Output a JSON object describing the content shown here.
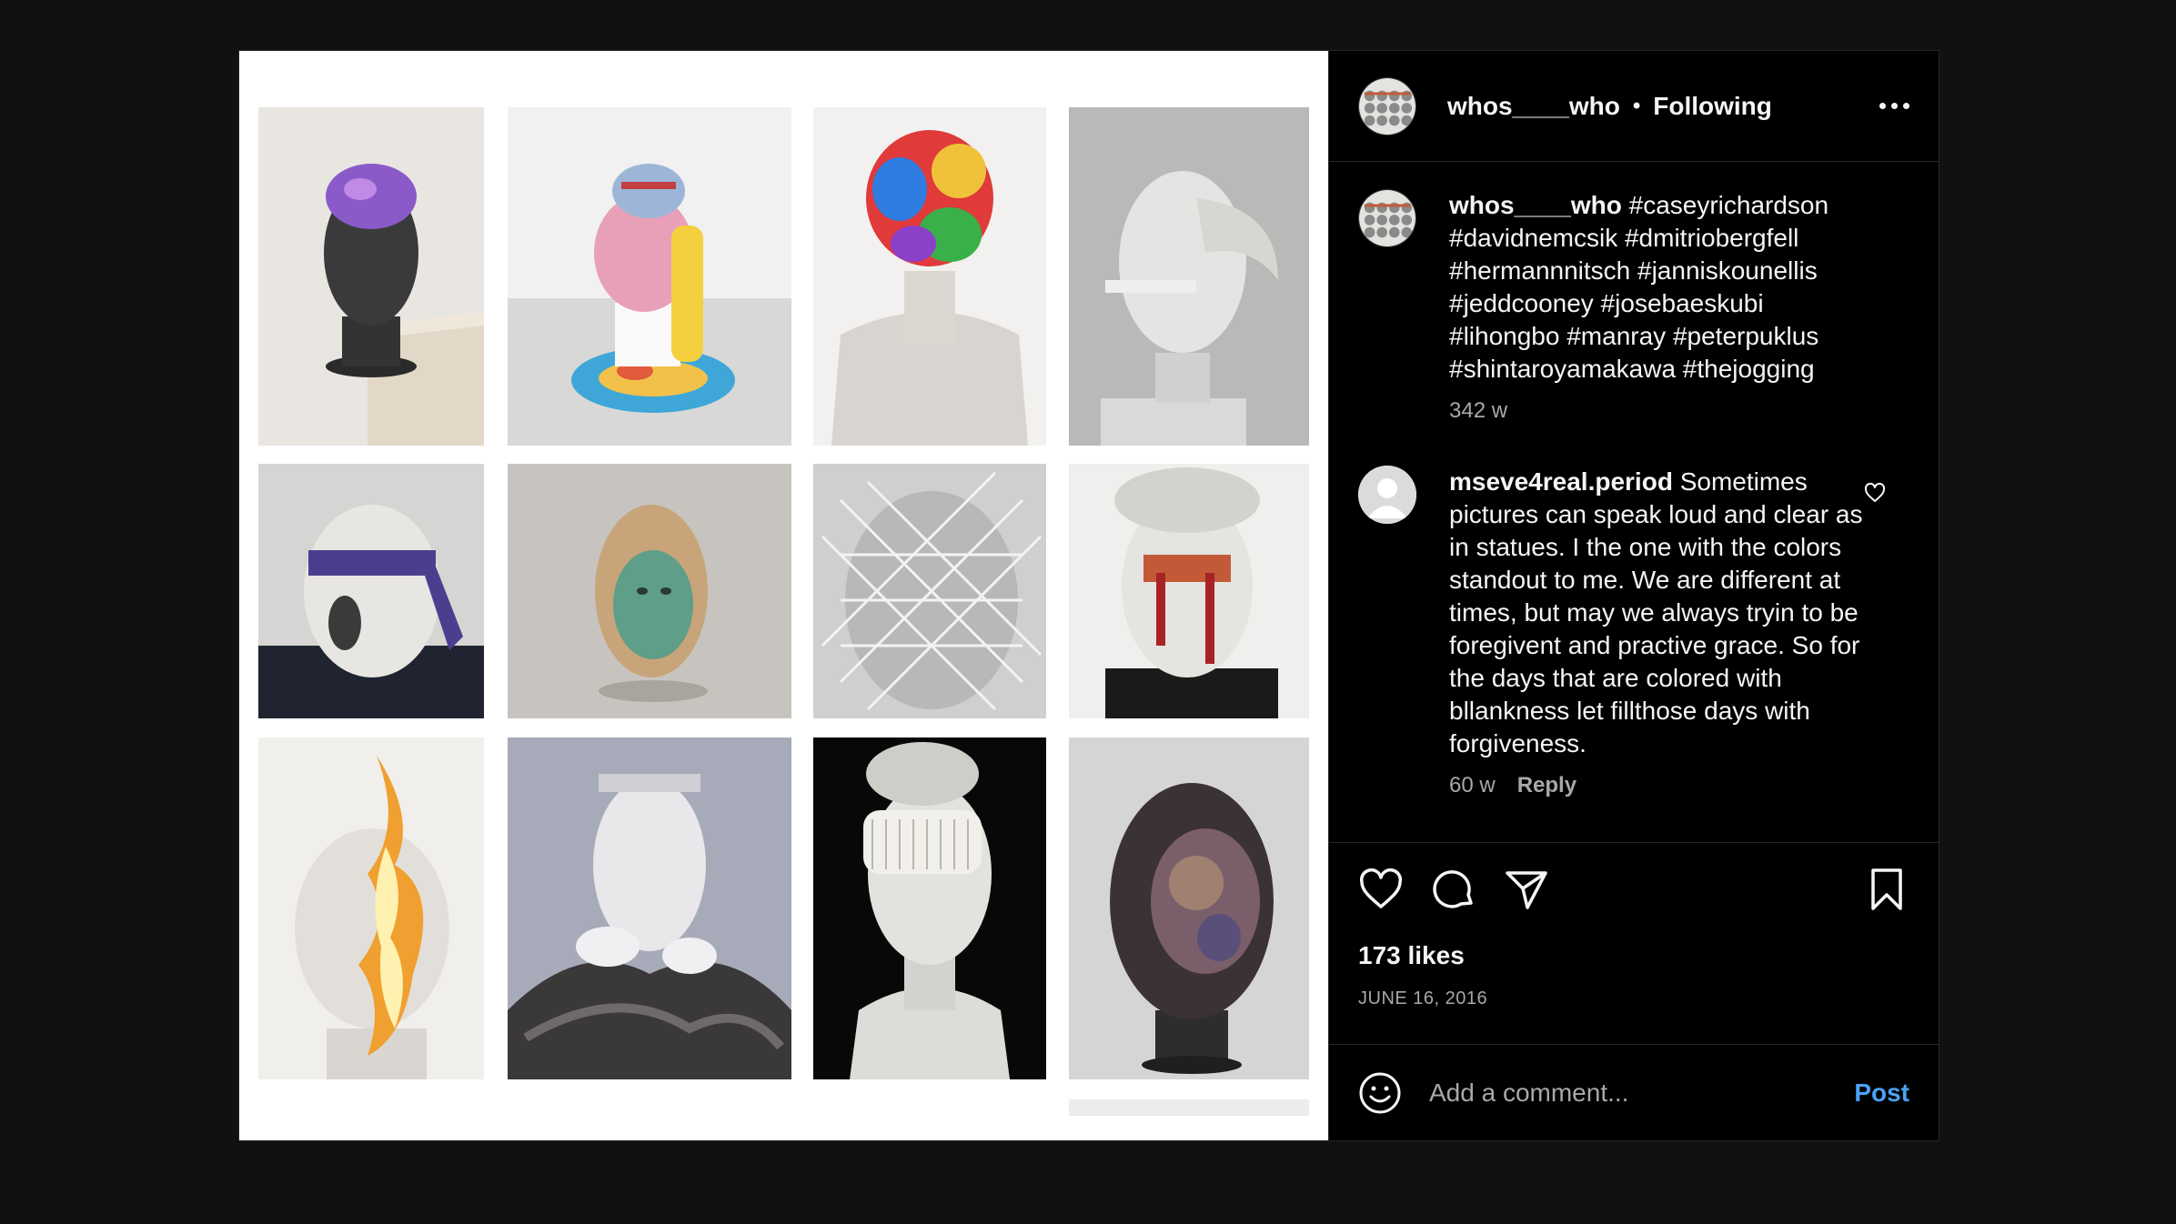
{
  "post": {
    "username": "whos____who",
    "separator": "•",
    "follow_state": "Following",
    "more_icon": "more-horizontal-icon"
  },
  "comments": [
    {
      "username": "whos____who",
      "text": "#caseyrichardson #davidnemcsik #dmitriobergfell #hermannnitsch #janniskounellis #jeddcooney #josebaeskubi #lihongbo #manray #peterpuklus #shintaroyamakawa #thejogging",
      "age": "342 w"
    },
    {
      "username": "mseve4real.period",
      "text": "Sometimes pictures can speak loud and clear as in statues. I the one with the colors standout to me. We are different at times, but may we always tryin to be foregivent and practive grace. So for the days that are colored with bllankness let fillthose days with forgiveness.",
      "age": "60 w",
      "reply_label": "Reply"
    }
  ],
  "actions": {
    "like_icon": "heart-icon",
    "comment_icon": "comment-bubble-icon",
    "share_icon": "paper-plane-icon",
    "save_icon": "bookmark-icon"
  },
  "likes": "173 likes",
  "date": "JUNE 16, 2016",
  "add_comment": {
    "placeholder": "Add a comment...",
    "post_label": "Post",
    "emoji_icon": "emoji-smile-icon"
  },
  "media": {
    "description_tiles": [
      "bust-iridescent-cap",
      "bust-pastel-inflatable",
      "bust-rainbow-fur",
      "bust-marble-profile",
      "bust-blindfolded",
      "bust-green-mask",
      "bust-netted",
      "bust-bleeding-eyes",
      "bust-burning",
      "bust-hands-silk",
      "bust-paint-roller",
      "bust-crystal-growth"
    ]
  }
}
